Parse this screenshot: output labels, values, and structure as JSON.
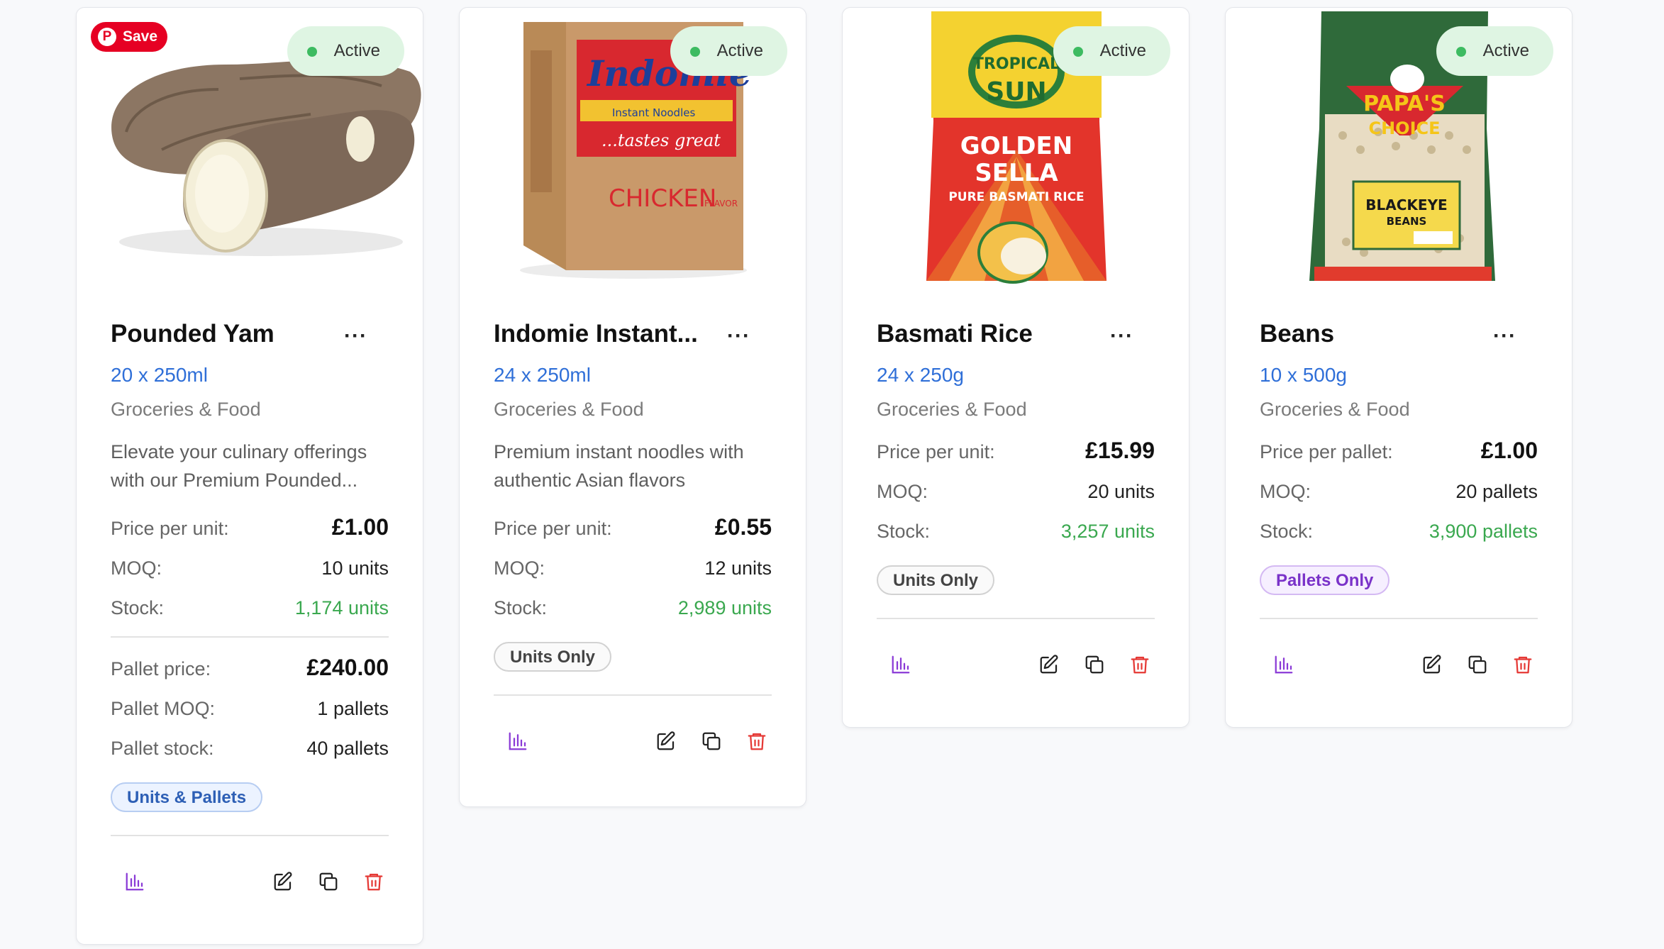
{
  "colors": {
    "accent_blue": "#2f6fd8",
    "stock_green": "#3aa84f",
    "active_bg": "#dff5e3",
    "active_dot": "#3dbb61",
    "delete_red": "#e53935",
    "analytics_purple": "#8a3ad6",
    "pinterest_red": "#e60023"
  },
  "save_overlay": {
    "label": "Save",
    "icon": "pinterest-icon"
  },
  "labels": {
    "price_per_unit": "Price per unit:",
    "price_per_pallet": "Price per pallet:",
    "moq": "MOQ:",
    "stock": "Stock:",
    "pallet_price": "Pallet price:",
    "pallet_moq": "Pallet MOQ:",
    "pallet_stock": "Pallet stock:",
    "more_menu": "···"
  },
  "icons": [
    "more-dots-icon",
    "bar-chart-icon",
    "edit-icon",
    "duplicate-icon",
    "trash-icon"
  ],
  "products": [
    {
      "status": "Active",
      "title": "Pounded Yam",
      "pack_size": "20 x 250ml",
      "category": "Groceries & Food",
      "description": "Elevate your culinary offerings with our Premium Pounded...",
      "price": "£1.00",
      "moq": "10 units",
      "stock": "1,174 units",
      "pallet_price": "£240.00",
      "pallet_moq": "1 pallets",
      "pallet_stock": "40 pallets",
      "sale_type": "Units & Pallets",
      "image": "yam-image"
    },
    {
      "status": "Active",
      "title": "Indomie Instant...",
      "pack_size": "24 x 250ml",
      "category": "Groceries & Food",
      "description": "Premium instant noodles with authentic Asian flavors",
      "price": "£0.55",
      "moq": "12 units",
      "stock": "2,989 units",
      "sale_type": "Units Only",
      "image": "indomie-box-image",
      "image_text": [
        "Indomie",
        "Instant Noodles",
        "...tastes great",
        "CHICKEN",
        "FLAVOR"
      ]
    },
    {
      "status": "Active",
      "title": "Basmati Rice",
      "pack_size": "24 x 250g",
      "category": "Groceries & Food",
      "price": "£15.99",
      "moq": "20 units",
      "stock": "3,257 units",
      "sale_type": "Units Only",
      "image": "rice-bag-image",
      "image_text": [
        "TROPICAL",
        "SUN",
        "GOLDEN",
        "SELLA",
        "PURE BASMATI RICE"
      ]
    },
    {
      "status": "Active",
      "title": "Beans",
      "pack_size": "10 x 500g",
      "category": "Groceries & Food",
      "price": "£1.00",
      "moq": "20 pallets",
      "stock": "3,900 pallets",
      "sale_type": "Pallets Only",
      "image": "beans-bag-image",
      "image_text": [
        "PAPA'S",
        "CHOICE",
        "BLACKEYE",
        "BEANS"
      ]
    }
  ]
}
